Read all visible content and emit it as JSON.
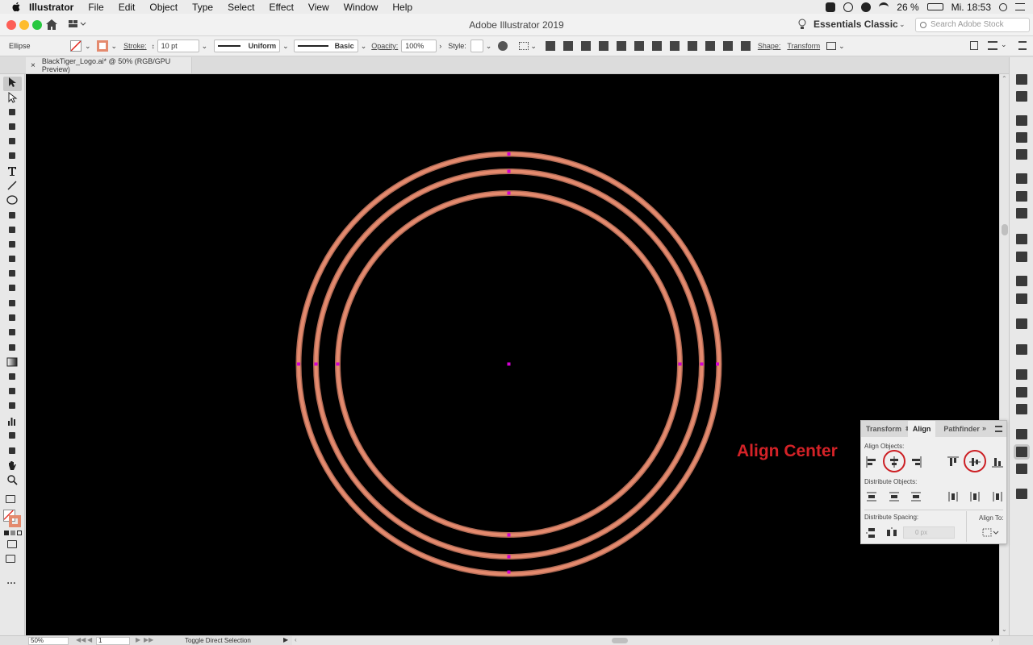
{
  "menubar": {
    "app_name": "Illustrator",
    "items": [
      "File",
      "Edit",
      "Object",
      "Type",
      "Select",
      "Effect",
      "View",
      "Window",
      "Help"
    ],
    "battery": "26 %",
    "clock": "Mi. 18:53"
  },
  "titlebar": {
    "title": "Adobe Illustrator 2019",
    "workspace": "Essentials Classic",
    "stock_placeholder": "Search Adobe Stock"
  },
  "controlbar": {
    "selection": "Ellipse",
    "stroke_label": "Stroke:",
    "stroke_value": "10 pt",
    "profile": "Uniform",
    "brush": "Basic",
    "opacity_label": "Opacity:",
    "opacity_value": "100%",
    "style_label": "Style:",
    "shape_label": "Shape:",
    "transform_label": "Transform"
  },
  "document_tab": {
    "title": "BlackTiger_Logo.ai* @ 50% (RGB/GPU Preview)"
  },
  "canvas": {
    "background": "#000000",
    "stroke_color": "#e48a6e",
    "anchor_color": "#d400d4",
    "annotation": "Align Center"
  },
  "align_panel": {
    "tabs": [
      "Transform",
      "Align",
      "Pathfinder"
    ],
    "active_tab": "Align",
    "align_objects_label": "Align Objects:",
    "distribute_objects_label": "Distribute Objects:",
    "distribute_spacing_label": "Distribute Spacing:",
    "align_to_label": "Align To:",
    "spacing_value": "0 px",
    "highlighted": [
      "horizontal-align-center",
      "vertical-align-center"
    ]
  },
  "statusbar": {
    "zoom": "50%",
    "artboard": "1",
    "status_text": "Toggle Direct Selection"
  }
}
